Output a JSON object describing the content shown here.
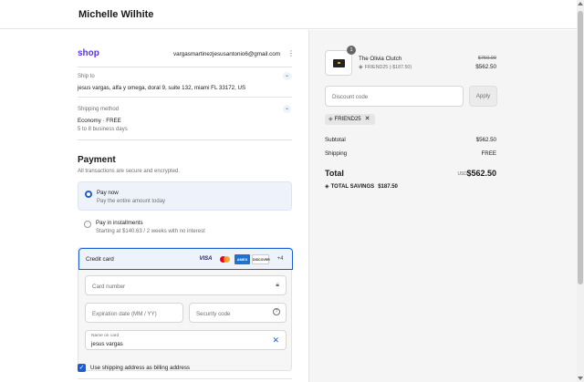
{
  "header": {
    "store_name": "Michelle Wilhite"
  },
  "account": {
    "logo": "shop",
    "email": "vargasmartinezjesusantonio6@gmail.com"
  },
  "ship_to": {
    "label": "Ship to",
    "address": "jesus vargas, alfa y omega, doral 9, suite 132, miami FL 33172, US"
  },
  "shipping_method": {
    "label": "Shipping method",
    "name": "Economy · FREE",
    "eta": "5 to 8 business days"
  },
  "payment": {
    "title": "Payment",
    "subtitle": "All transactions are secure and encrypted.",
    "options": [
      {
        "title": "Pay now",
        "desc": "Pay the entire amount today",
        "selected": true
      },
      {
        "title": "Pay in installments",
        "desc": "Starting at $140.63 / 2 weeks with no interest",
        "selected": false
      }
    ],
    "card": {
      "label": "Credit card",
      "brands": [
        "VISA",
        "mastercard",
        "AMEX",
        "DISCOVER"
      ],
      "more": "+4",
      "number_placeholder": "Card number",
      "expiry_placeholder": "Expiration date (MM / YY)",
      "cvv_placeholder": "Security code",
      "name_label": "Name on card",
      "name_value": "jesus vargas"
    },
    "billing_checkbox": {
      "label": "Use shipping address as billing address",
      "checked": true
    }
  },
  "summary": {
    "item": {
      "quantity": "1",
      "name": "The Olivia Clutch",
      "discount": "FRIEND25 (-$187.50)",
      "original_price": "$750.00",
      "price": "$562.50"
    },
    "discount_placeholder": "Discount code",
    "apply_label": "Apply",
    "applied_code": "FRIEND25",
    "subtotal_label": "Subtotal",
    "subtotal": "$562.50",
    "shipping_label": "Shipping",
    "shipping": "FREE",
    "total_label": "Total",
    "currency": "USD",
    "total": "$562.50",
    "savings_label": "TOTAL SAVINGS",
    "savings": "$187.50"
  },
  "colors": {
    "accent": "#1a5fd1",
    "shop_brand": "#5a31f4",
    "summary_bg": "#f5f5f5"
  },
  "icons": [
    "kebab-icon",
    "chevron-down-icon",
    "lock-icon",
    "help-icon",
    "close-icon",
    "tag-icon",
    "check-icon"
  ]
}
